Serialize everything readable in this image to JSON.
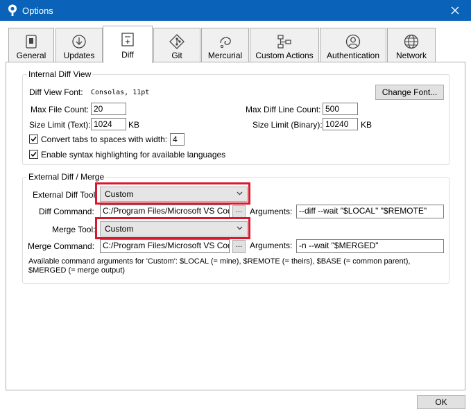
{
  "window": {
    "title": "Options"
  },
  "tabs": [
    {
      "label": "General",
      "icon": "general-icon"
    },
    {
      "label": "Updates",
      "icon": "download-icon"
    },
    {
      "label": "Diff",
      "icon": "diff-icon",
      "active": true
    },
    {
      "label": "Git",
      "icon": "git-icon"
    },
    {
      "label": "Mercurial",
      "icon": "mercurial-icon"
    },
    {
      "label": "Custom Actions",
      "icon": "custom-actions-icon"
    },
    {
      "label": "Authentication",
      "icon": "user-icon"
    },
    {
      "label": "Network",
      "icon": "globe-icon"
    }
  ],
  "internal_diff": {
    "title": "Internal Diff View",
    "font_label": "Diff View Font:",
    "font_value": "Consolas, 11pt",
    "change_font": "Change Font...",
    "max_file_count_label": "Max File Count:",
    "max_file_count": "20",
    "max_line_count_label": "Max Diff Line Count:",
    "max_line_count": "500",
    "size_text_label": "Size Limit (Text):",
    "size_text": "1024",
    "size_text_unit": "KB",
    "size_binary_label": "Size Limit (Binary):",
    "size_binary": "10240",
    "size_binary_unit": "KB",
    "tabs_label": "Convert tabs to spaces with width:",
    "tabs_checked": true,
    "tab_width": "4",
    "syntax_label": "Enable syntax highlighting for available languages",
    "syntax_checked": true
  },
  "external_diff": {
    "title": "External Diff / Merge",
    "diff_tool_label": "External Diff Tool:",
    "diff_tool": "Custom",
    "diff_command_label": "Diff Command:",
    "diff_command": "C:/Program Files/Microsoft VS Code/Code.exe",
    "browse": "...",
    "arguments_label": "Arguments:",
    "diff_arguments": "--diff --wait \"$LOCAL\" \"$REMOTE\"",
    "merge_tool_label": "Merge Tool:",
    "merge_tool": "Custom",
    "merge_command_label": "Merge Command:",
    "merge_command": "C:/Program Files/Microsoft VS Code/Code.exe",
    "merge_arguments": "-n --wait \"$MERGED\"",
    "help_line1": "Available command arguments for 'Custom': $LOCAL (= mine), $REMOTE (= theirs), $BASE (= common parent),",
    "help_line2": "$MERGED (= merge output)"
  },
  "footer": {
    "ok": "OK"
  },
  "colors": {
    "titlebar": "#0a63b8",
    "highlight": "#d9182d"
  }
}
